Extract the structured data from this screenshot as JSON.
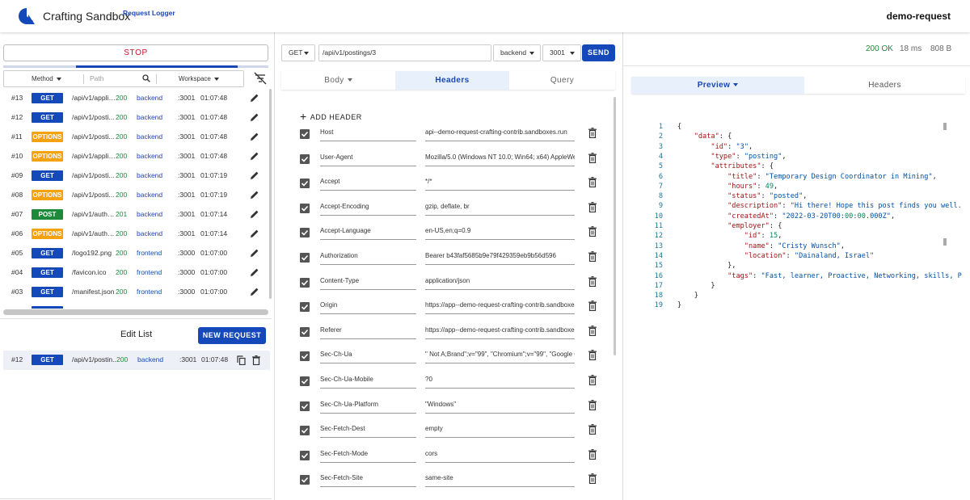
{
  "header": {
    "title": "Crafting Sandbox",
    "subtitle": "Request Logger",
    "sandbox_name": "demo-request"
  },
  "left": {
    "stop_label": "STOP",
    "filter": {
      "method_label": "Method",
      "path_placeholder": "Path",
      "workspace_label": "Workspace"
    },
    "requests": [
      {
        "num": "#13",
        "method": "GET",
        "path": "/api/v1/applic...",
        "status": "200",
        "workspace": "backend",
        "port": ":3001",
        "time": "01:07:48"
      },
      {
        "num": "#12",
        "method": "GET",
        "path": "/api/v1/posti...",
        "status": "200",
        "workspace": "backend",
        "port": ":3001",
        "time": "01:07:48"
      },
      {
        "num": "#11",
        "method": "OPTIONS",
        "path": "/api/v1/posti...",
        "status": "200",
        "workspace": "backend",
        "port": ":3001",
        "time": "01:07:48"
      },
      {
        "num": "#10",
        "method": "OPTIONS",
        "path": "/api/v1/applic...",
        "status": "200",
        "workspace": "backend",
        "port": ":3001",
        "time": "01:07:48"
      },
      {
        "num": "#09",
        "method": "GET",
        "path": "/api/v1/posti...",
        "status": "200",
        "workspace": "backend",
        "port": ":3001",
        "time": "01:07:19"
      },
      {
        "num": "#08",
        "method": "OPTIONS",
        "path": "/api/v1/posti...",
        "status": "200",
        "workspace": "backend",
        "port": ":3001",
        "time": "01:07:19"
      },
      {
        "num": "#07",
        "method": "POST",
        "path": "/api/v1/authe...",
        "status": "201",
        "workspace": "backend",
        "port": ":3001",
        "time": "01:07:14"
      },
      {
        "num": "#06",
        "method": "OPTIONS",
        "path": "/api/v1/authe...",
        "status": "200",
        "workspace": "backend",
        "port": ":3001",
        "time": "01:07:14"
      },
      {
        "num": "#05",
        "method": "GET",
        "path": "/logo192.png",
        "status": "200",
        "workspace": "frontend",
        "port": ":3000",
        "time": "01:07:00"
      },
      {
        "num": "#04",
        "method": "GET",
        "path": "/favicon.ico",
        "status": "200",
        "workspace": "frontend",
        "port": ":3000",
        "time": "01:07:00"
      },
      {
        "num": "#03",
        "method": "GET",
        "path": "/manifest.json",
        "status": "200",
        "workspace": "frontend",
        "port": ":3000",
        "time": "01:07:00"
      }
    ],
    "edit_list_title": "Edit List",
    "new_request_label": "NEW REQUEST",
    "edit_items": [
      {
        "num": "#12",
        "method": "GET",
        "path": "/api/v1/postin...",
        "status": "200",
        "workspace": "backend",
        "port": ":3001",
        "time": "01:07:48"
      }
    ]
  },
  "middle": {
    "method": "GET",
    "url": "/api/v1/postings/3",
    "workspace": "backend",
    "port": "3001",
    "send_label": "SEND",
    "tabs": {
      "body": "Body",
      "headers": "Headers",
      "query": "Query"
    },
    "add_header_label": "ADD HEADER",
    "headers": [
      {
        "name": "Host",
        "value": "api--demo-request-crafting-contrib.sandboxes.run"
      },
      {
        "name": "User-Agent",
        "value": "Mozilla/5.0 (Windows NT 10.0; Win64; x64) AppleWebKit/537.36"
      },
      {
        "name": "Accept",
        "value": "*/*"
      },
      {
        "name": "Accept-Encoding",
        "value": "gzip, deflate, br"
      },
      {
        "name": "Accept-Language",
        "value": "en-US,en;q=0.9"
      },
      {
        "name": "Authorization",
        "value": "Bearer b43faf5685b9e79f429359eb9b56d596"
      },
      {
        "name": "Content-Type",
        "value": "application/json"
      },
      {
        "name": "Origin",
        "value": "https://app--demo-request-crafting-contrib.sandboxes.run"
      },
      {
        "name": "Referer",
        "value": "https://app--demo-request-crafting-contrib.sandboxes.run/"
      },
      {
        "name": "Sec-Ch-Ua",
        "value": "\" Not A;Brand\";v=\"99\", \"Chromium\";v=\"99\", \"Google Chrome\";v=\"99\""
      },
      {
        "name": "Sec-Ch-Ua-Mobile",
        "value": "?0"
      },
      {
        "name": "Sec-Ch-Ua-Platform",
        "value": "\"Windows\""
      },
      {
        "name": "Sec-Fetch-Dest",
        "value": "empty"
      },
      {
        "name": "Sec-Fetch-Mode",
        "value": "cors"
      },
      {
        "name": "Sec-Fetch-Site",
        "value": "same-site"
      }
    ]
  },
  "right": {
    "status": "200 OK",
    "time": "18 ms",
    "size": "808 B",
    "tabs": {
      "preview": "Preview",
      "headers": "Headers"
    },
    "code_lines": [
      "{",
      "    \"data\": {",
      "        \"id\": \"3\",",
      "        \"type\": \"posting\",",
      "        \"attributes\": {",
      "            \"title\": \"Temporary Design Coordinator in Mining\",",
      "            \"hours\": 49,",
      "            \"status\": \"posted\",",
      "            \"description\": \"Hi there! Hope this post finds you well.",
      "            \"createdAt\": \"2022-03-20T00:00:00.000Z\",",
      "            \"employer\": {",
      "                \"id\": 15,",
      "                \"name\": \"Cristy Wunsch\",",
      "                \"location\": \"Dainaland, Israel\"",
      "            },",
      "            \"tags\": \"Fast, learner, Proactive, Networking, skills, P",
      "        }",
      "    }",
      "}"
    ]
  },
  "colors": {
    "primary": "#1548b8",
    "get": "#1548b8",
    "options": "#f5a20c",
    "post": "#1c8a3a",
    "success": "#1c8a3a",
    "stop": "#c8102e"
  }
}
